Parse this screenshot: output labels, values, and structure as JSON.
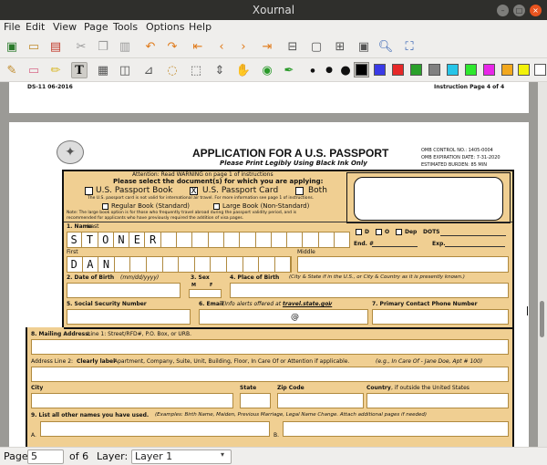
{
  "window": {
    "title": "Xournal"
  },
  "menu": [
    "File",
    "Edit",
    "View",
    "Page",
    "Tools",
    "Options",
    "Help"
  ],
  "toolbar_icons": {
    "row1": [
      "save-icon",
      "open-icon",
      "print-icon",
      "cut-icon",
      "copy-icon",
      "paste-icon",
      "undo-icon",
      "redo-icon",
      "first-page-icon",
      "prev-page-icon",
      "next-page-icon",
      "last-page-icon",
      "zoom-out-icon",
      "zoom-fit-icon",
      "zoom-in-icon",
      "zoom-width-icon",
      "search-icon",
      "fullscreen-icon"
    ],
    "row2": [
      "pen-icon",
      "eraser-icon",
      "highlighter-icon",
      "text-tool-icon",
      "image-tool-icon",
      "shape-recognizer-icon",
      "ruler-icon",
      "select-region-icon",
      "select-rect-icon",
      "vertical-space-icon",
      "hand-icon",
      "default-tool-icon",
      "default-pen-icon",
      "thin-icon",
      "medium-icon",
      "thick-icon"
    ]
  },
  "colors": [
    "#000000",
    "#3a3ae6",
    "#e62828",
    "#2aa02a",
    "#808080",
    "#26c5e8",
    "#2ee82e",
    "#e826e8",
    "#f2a81e",
    "#f2f20a",
    "#ffffff"
  ],
  "page_header": {
    "left": "DS-11  06-2016",
    "right": "Instruction Page 4 of 4"
  },
  "form": {
    "title": "APPLICATION FOR A U.S. PASSPORT",
    "subtitle": "Please Print Legibly Using Black Ink Only",
    "omb": [
      "OMB CONTROL NO.: 1405-0004",
      "OMB EXPIRATION DATE: 7-31-2020",
      "ESTIMATED BURDEN: 85 MIN"
    ],
    "attention": "Attention: Read WARNING on page 1 of instructions",
    "select_docs": "Please select the document(s) for which you are applying:",
    "passport_book": "U.S. Passport Book",
    "passport_card": "U.S. Passport Card",
    "both": "Both",
    "card_note": "The U.S. passport card is not valid for international air travel.  For more information see page 1 of instructions.",
    "regular_book": "Regular Book (Standard)",
    "large_book": "Large Book (Non-Standard)",
    "large_note_1": "Note: The large book option is for those who frequently travel abroad during the passport validity period, and is",
    "large_note_2": "recommended for applicants who have previously required the addition of visa pages.",
    "card_checked": "X",
    "office_d": "D",
    "office_o": "O",
    "office_dep": "Dep",
    "office_dots": "DOTS",
    "end_no": "End. #",
    "exp": "Exp.",
    "name_label": "1. Name",
    "last_label": "Last",
    "last_letters": [
      "S",
      "T",
      "O",
      "N",
      "E",
      "R"
    ],
    "first_label": "First",
    "first_letters": [
      "D",
      "A",
      "N"
    ],
    "middle_label": "Middle",
    "dob_label": "2. Date of Birth",
    "dob_hint": "(mm/dd/yyyy)",
    "sex_label": "3. Sex",
    "sex_m": "M",
    "sex_f": "F",
    "pob_label": "4. Place of Birth",
    "pob_hint": "(City & State if in the U.S., or City & Country as it is presently known.)",
    "ssn_label": "5. Social Security Number",
    "email_label": "6. Email",
    "email_hint": "(Info alerts offered at",
    "email_site": "travel.state.gov",
    "email_close": ")",
    "at_sign": "@",
    "phone_label": "7. Primary Contact Phone Number",
    "mail_label": "8. Mailing Address:",
    "mail_hint": "Line 1: Street/RFD#, P.O. Box, or URB.",
    "addr2_prefix": "Address Line 2:",
    "addr2_bold": "Clearly label",
    "addr2_rest": "Apartment, Company, Suite, Unit, Building, Floor, In Care Of or Attention if applicable.",
    "addr2_example": "(e.g., In Care Of - Jane Doe, Apt # 100)",
    "city": "City",
    "state": "State",
    "zip": "Zip Code",
    "country_bold": "Country",
    "country_rest": ", if outside the United States",
    "other_names_label": "9. List all other names you have used.",
    "other_names_hint": "(Examples: Birth Name, Maiden, Previous Marriage, Legal Name Change.  Attach additional  pages if needed)",
    "other_a": "A.",
    "other_b": "B."
  },
  "status": {
    "page_label": "Page",
    "page_value": "5",
    "of_pages": "of 6",
    "layer_label": "Layer:",
    "layer_value": "Layer 1"
  }
}
